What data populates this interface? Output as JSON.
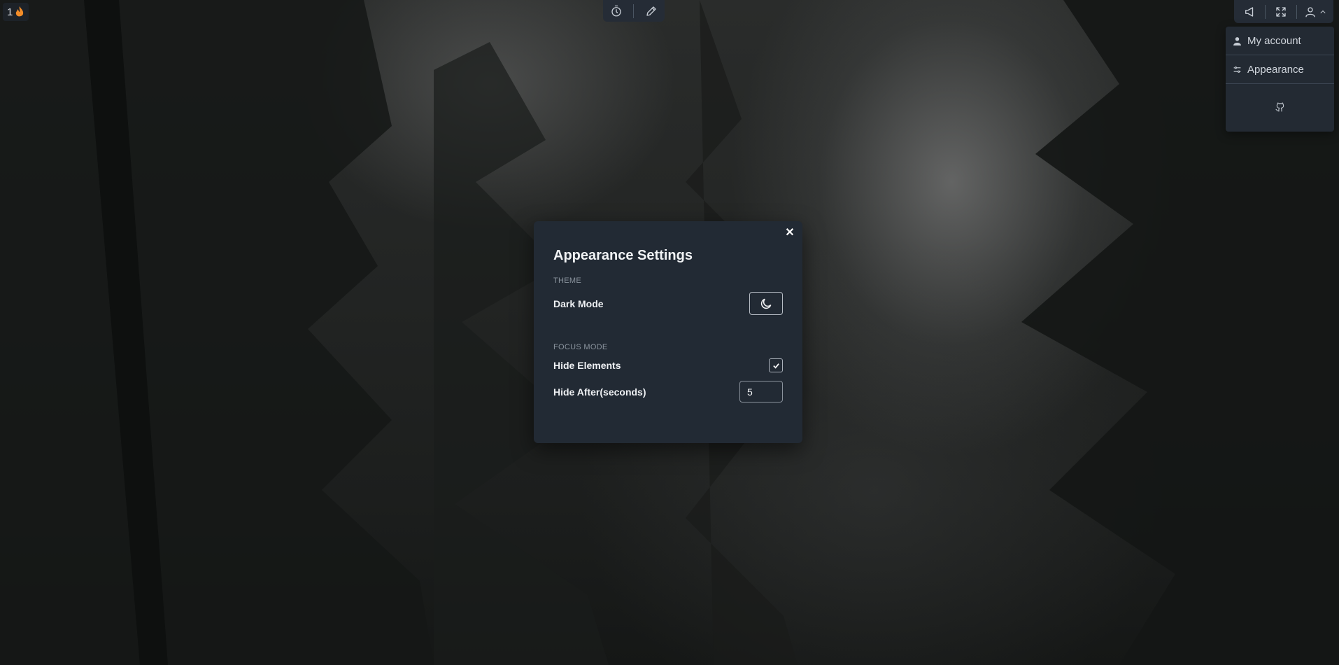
{
  "streak": {
    "count": "1",
    "icon": "flame-icon",
    "color": "#f28c28"
  },
  "toolbar_center": {
    "icons": [
      "timer-icon",
      "pencil-icon"
    ]
  },
  "toolbar_right": {
    "icons": [
      "volume-icon",
      "fullscreen-icon",
      "user-icon",
      "chevron-up-icon"
    ]
  },
  "menu": {
    "items": [
      {
        "label": "My account",
        "icon": "user-icon"
      },
      {
        "label": "Appearance",
        "icon": "sliders-icon"
      }
    ],
    "footer_icon": "github-icon"
  },
  "modal": {
    "title": "Appearance Settings",
    "close_icon": "close-icon",
    "theme": {
      "section": "THEME",
      "dark_mode_label": "Dark Mode",
      "toggle_icon": "moon-icon"
    },
    "focus": {
      "section": "FOCUS MODE",
      "hide_elements_label": "Hide Elements",
      "hide_elements_checked": true,
      "hide_after_label": "Hide After(seconds)",
      "hide_after_value": "5"
    }
  }
}
